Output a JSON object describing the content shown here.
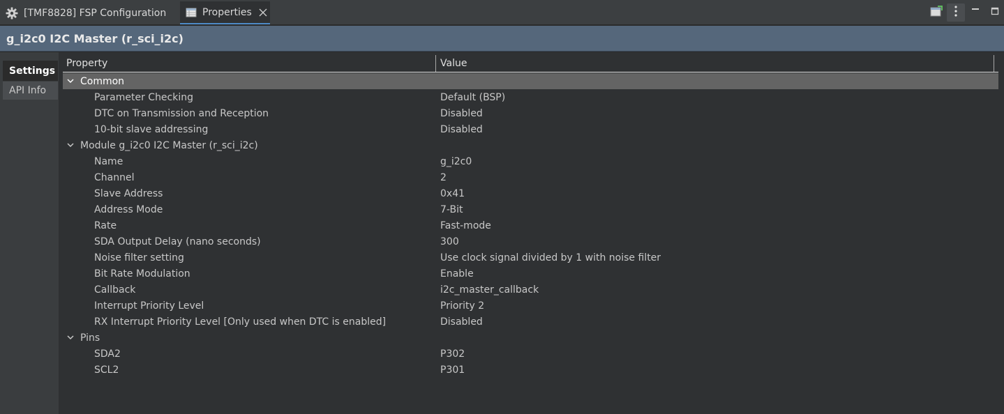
{
  "tabs": [
    {
      "label": "[TMF8828] FSP Configuration",
      "icon": "gear-icon"
    },
    {
      "label": "Properties",
      "icon": "properties-table-icon",
      "active": true
    }
  ],
  "banner": {
    "title": "g_i2c0 I2C Master (r_sci_i2c)"
  },
  "sidetabs": [
    {
      "label": "Settings",
      "active": true
    },
    {
      "label": "API Info"
    }
  ],
  "table": {
    "col_property": "Property",
    "col_value": "Value"
  },
  "rows": [
    {
      "type": "group",
      "label": "Common",
      "selected": true
    },
    {
      "type": "leaf",
      "label": "Parameter Checking",
      "value": "Default (BSP)"
    },
    {
      "type": "leaf",
      "label": "DTC on Transmission and Reception",
      "value": "Disabled"
    },
    {
      "type": "leaf",
      "label": "10-bit slave addressing",
      "value": "Disabled"
    },
    {
      "type": "group",
      "label": "Module g_i2c0 I2C Master (r_sci_i2c)"
    },
    {
      "type": "leaf",
      "label": "Name",
      "value": "g_i2c0"
    },
    {
      "type": "leaf",
      "label": "Channel",
      "value": "2"
    },
    {
      "type": "leaf",
      "label": "Slave Address",
      "value": "0x41"
    },
    {
      "type": "leaf",
      "label": "Address Mode",
      "value": "7-Bit"
    },
    {
      "type": "leaf",
      "label": "Rate",
      "value": "Fast-mode"
    },
    {
      "type": "leaf",
      "label": "SDA Output Delay (nano seconds)",
      "value": "300"
    },
    {
      "type": "leaf",
      "label": "Noise filter setting",
      "value": "Use clock signal divided by 1 with noise filter"
    },
    {
      "type": "leaf",
      "label": "Bit Rate Modulation",
      "value": "Enable"
    },
    {
      "type": "leaf",
      "label": "Callback",
      "value": "i2c_master_callback"
    },
    {
      "type": "leaf",
      "label": "Interrupt Priority Level",
      "value": "Priority 2"
    },
    {
      "type": "leaf",
      "label": "RX Interrupt Priority Level [Only used when DTC is enabled]",
      "value": "Disabled"
    },
    {
      "type": "group",
      "label": "Pins"
    },
    {
      "type": "leaf",
      "label": "SDA2",
      "value": "P302"
    },
    {
      "type": "leaf",
      "label": "SCL2",
      "value": "P301"
    }
  ],
  "colors": {
    "accent": "#4e8ac6",
    "banner": "#55677b",
    "selected_row": "#646464",
    "background": "#2f3133"
  }
}
